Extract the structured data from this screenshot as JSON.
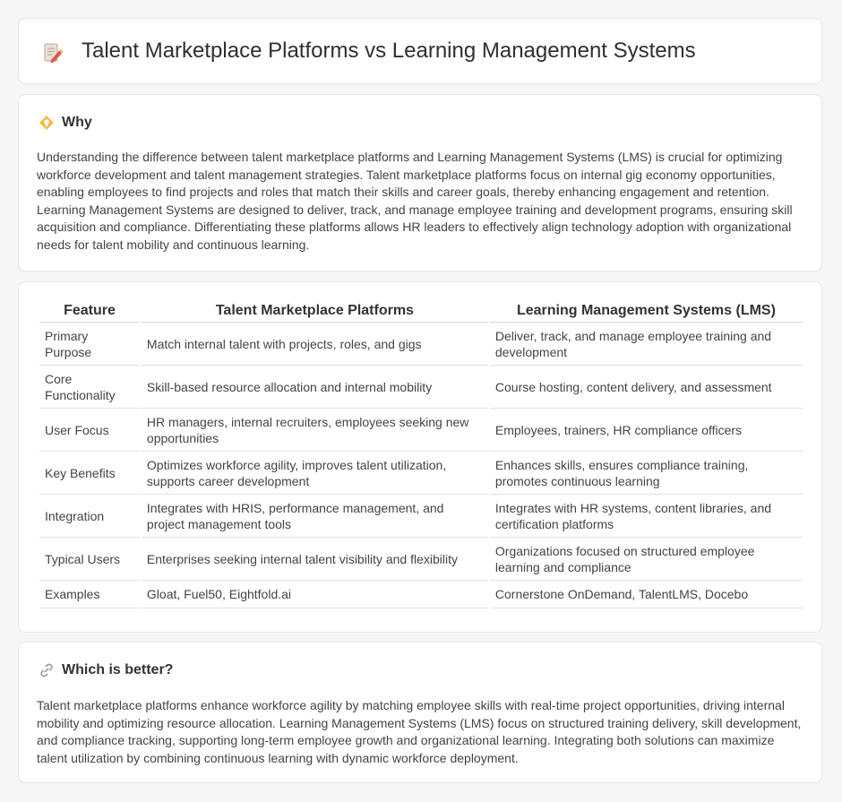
{
  "header": {
    "title": "Talent Marketplace Platforms vs Learning Management Systems",
    "icon": "document-pencil-icon"
  },
  "why": {
    "title": "Why",
    "icon": "lightbulb-icon",
    "text": "Understanding the difference between talent marketplace platforms and Learning Management Systems (LMS) is crucial for optimizing workforce development and talent management strategies. Talent marketplace platforms focus on internal gig economy opportunities, enabling employees to find projects and roles that match their skills and career goals, thereby enhancing engagement and retention. Learning Management Systems are designed to deliver, track, and manage employee training and development programs, ensuring skill acquisition and compliance. Differentiating these platforms allows HR leaders to effectively align technology adoption with organizational needs for talent mobility and continuous learning."
  },
  "table": {
    "headers": [
      "Feature",
      "Talent Marketplace Platforms",
      "Learning Management Systems (LMS)"
    ],
    "rows": [
      [
        "Primary Purpose",
        "Match internal talent with projects, roles, and gigs",
        "Deliver, track, and manage employee training and development"
      ],
      [
        "Core Functionality",
        "Skill-based resource allocation and internal mobility",
        "Course hosting, content delivery, and assessment"
      ],
      [
        "User Focus",
        "HR managers, internal recruiters, employees seeking new opportunities",
        "Employees, trainers, HR compliance officers"
      ],
      [
        "Key Benefits",
        "Optimizes workforce agility, improves talent utilization, supports career development",
        "Enhances skills, ensures compliance training, promotes continuous learning"
      ],
      [
        "Integration",
        "Integrates with HRIS, performance management, and project management tools",
        "Integrates with HR systems, content libraries, and certification platforms"
      ],
      [
        "Typical Users",
        "Enterprises seeking internal talent visibility and flexibility",
        "Organizations focused on structured employee learning and compliance"
      ],
      [
        "Examples",
        "Gloat, Fuel50, Eightfold.ai",
        "Cornerstone OnDemand, TalentLMS, Docebo"
      ]
    ]
  },
  "better": {
    "title": "Which is better?",
    "icon": "link-icon",
    "text": "Talent marketplace platforms enhance workforce agility by matching employee skills with real-time project opportunities, driving internal mobility and optimizing resource allocation. Learning Management Systems (LMS) focus on structured training delivery, skill development, and compliance tracking, supporting long-term employee growth and organizational learning. Integrating both solutions can maximize talent utilization by combining continuous learning with dynamic workforce deployment."
  }
}
